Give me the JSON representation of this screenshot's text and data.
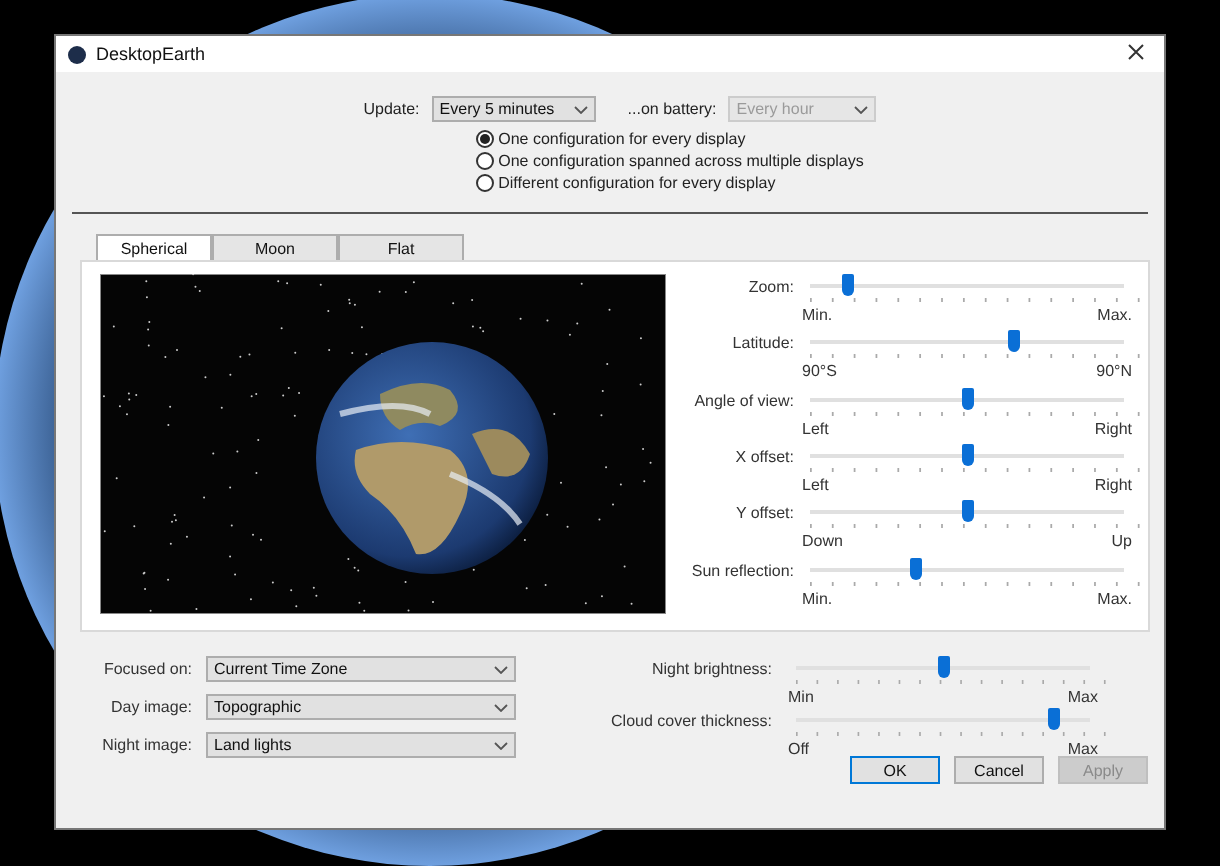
{
  "window": {
    "title": "DesktopEarth"
  },
  "update": {
    "label": "Update:",
    "value": "Every 5 minutes",
    "disabled": false
  },
  "battery": {
    "label": "...on battery:",
    "value": "Every hour",
    "disabled": true
  },
  "display_modes": [
    {
      "label": "One configuration for every display",
      "selected": true
    },
    {
      "label": "One configuration spanned across multiple displays",
      "selected": false
    },
    {
      "label": "Different configuration for every display",
      "selected": false
    }
  ],
  "tabs": [
    {
      "label": "Spherical",
      "selected": true
    },
    {
      "label": "Moon",
      "selected": false
    },
    {
      "label": "Flat",
      "selected": false
    }
  ],
  "sliders": [
    {
      "label": "Zoom:",
      "min": "Min.",
      "max": "Max.",
      "level": 0.12
    },
    {
      "label": "Latitude:",
      "min": "90°S",
      "max": "90°N",
      "level": 0.65
    },
    {
      "label": "Angle of view:",
      "min": "Left",
      "max": "Right",
      "level": 0.5
    },
    {
      "label": "X offset:",
      "min": "Left",
      "max": "Right",
      "level": 0.5
    },
    {
      "label": "Y offset:",
      "min": "Down",
      "max": "Up",
      "level": 0.5
    },
    {
      "label": "Sun reflection:",
      "min": "Min.",
      "max": "Max.",
      "level": 0.34
    }
  ],
  "image_settings": [
    {
      "label": "Focused on:",
      "value": "Current Time Zone"
    },
    {
      "label": "Day image:",
      "value": "Topographic"
    },
    {
      "label": "Night image:",
      "value": "Land lights"
    }
  ],
  "bottom_sliders": [
    {
      "label": "Night brightness:",
      "min": "Min",
      "max": "Max",
      "level": 0.5
    },
    {
      "label": "Cloud cover thickness:",
      "min": "Off",
      "max": "Max",
      "level": 0.88
    }
  ],
  "buttons": [
    {
      "label": "OK",
      "kind": "default",
      "disabled": false
    },
    {
      "label": "Cancel",
      "kind": "normal",
      "disabled": false
    },
    {
      "label": "Apply",
      "kind": "normal",
      "disabled": true
    }
  ]
}
